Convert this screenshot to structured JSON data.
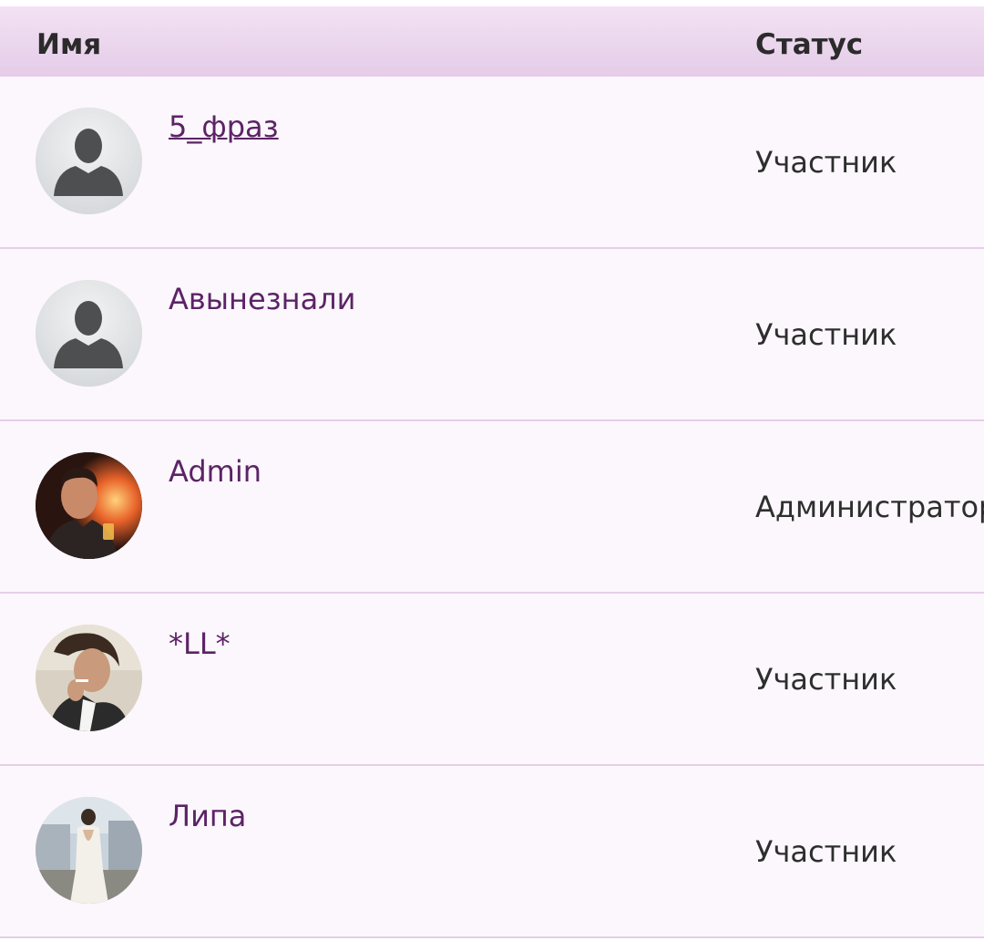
{
  "table": {
    "headers": {
      "name": "Имя",
      "status": "Статус"
    },
    "rows": [
      {
        "name": "5_фраз",
        "status": "Участник",
        "avatar": "default-user-avatar",
        "underlined": true
      },
      {
        "name": "Авынезнали",
        "status": "Участник",
        "avatar": "default-user-avatar",
        "underlined": false
      },
      {
        "name": "Admin",
        "status": "Администратор",
        "avatar": "photo-man-fire-avatar",
        "underlined": false
      },
      {
        "name": "*LL*",
        "status": "Участник",
        "avatar": "photo-man-cigarette-avatar",
        "underlined": false
      },
      {
        "name": "Липа",
        "status": "Участник",
        "avatar": "photo-woman-dress-avatar",
        "underlined": false
      }
    ]
  },
  "colors": {
    "header_bg": "#e9d4eb",
    "row_bg": "#fbf7fc",
    "divider": "#e7cdea",
    "username": "#5c2366",
    "status_text": "#2e2e2e"
  }
}
